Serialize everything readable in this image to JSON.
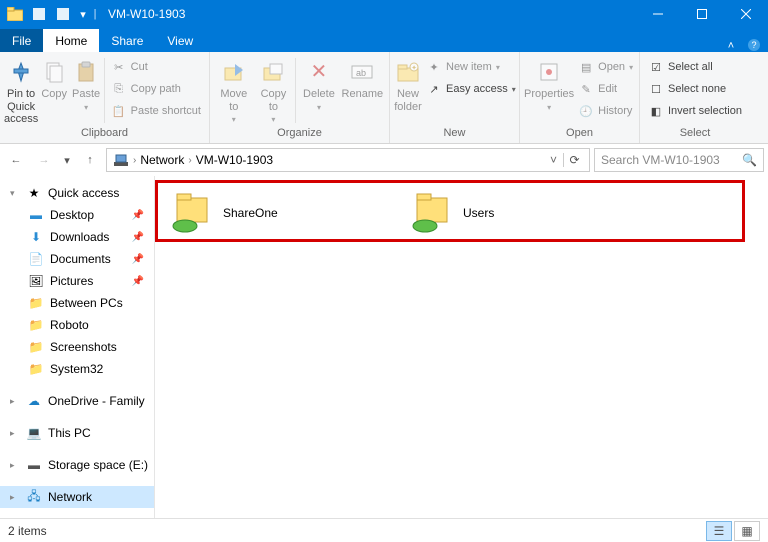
{
  "window": {
    "title": "VM-W10-1903"
  },
  "tabs": {
    "file": "File",
    "home": "Home",
    "share": "Share",
    "view": "View"
  },
  "ribbon": {
    "clipboard": {
      "label": "Clipboard",
      "pin": "Pin to Quick\naccess",
      "copy": "Copy",
      "paste": "Paste",
      "cut": "Cut",
      "copy_path": "Copy path",
      "paste_shortcut": "Paste shortcut"
    },
    "organize": {
      "label": "Organize",
      "move_to": "Move\nto",
      "copy_to": "Copy\nto",
      "delete": "Delete",
      "rename": "Rename"
    },
    "new": {
      "label": "New",
      "new_folder": "New\nfolder",
      "new_item": "New item",
      "easy_access": "Easy access"
    },
    "open": {
      "label": "Open",
      "properties": "Properties",
      "open": "Open",
      "edit": "Edit",
      "history": "History"
    },
    "select": {
      "label": "Select",
      "select_all": "Select all",
      "select_none": "Select none",
      "invert": "Invert selection"
    }
  },
  "breadcrumb": {
    "root": "Network",
    "loc": "VM-W10-1903"
  },
  "search": {
    "placeholder": "Search VM-W10-1903"
  },
  "nav": {
    "quick_access": "Quick access",
    "desktop": "Desktop",
    "downloads": "Downloads",
    "documents": "Documents",
    "pictures": "Pictures",
    "between_pcs": "Between PCs",
    "roboto": "Roboto",
    "screenshots": "Screenshots",
    "system32": "System32",
    "onedrive": "OneDrive - Family",
    "this_pc": "This PC",
    "storage": "Storage space (E:)",
    "network": "Network"
  },
  "content": {
    "share1": "ShareOne",
    "share2": "Users"
  },
  "status": {
    "count": "2 items"
  }
}
